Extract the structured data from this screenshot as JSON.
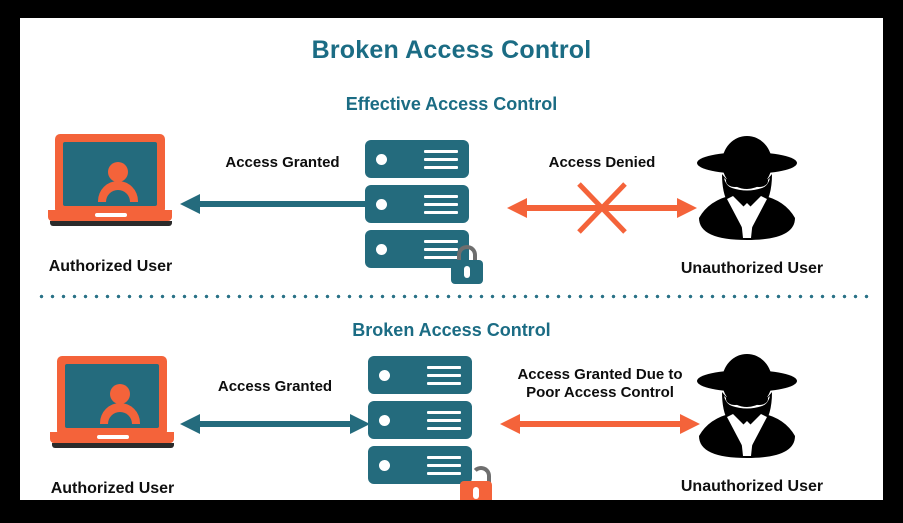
{
  "diagram": {
    "title": "Broken Access Control",
    "colors": {
      "teal": "#246b7d",
      "orange": "#f4633a",
      "title_teal": "#1b6c84",
      "black": "#000000",
      "canvas": "#ffffff"
    },
    "sections": [
      {
        "id": "effective",
        "heading": "Effective Access Control",
        "left_actor": {
          "icon": "laptop-user-icon",
          "label": "Authorized User"
        },
        "left_arrow": {
          "label": "Access Granted",
          "color": "#246b7d",
          "direction": "both",
          "blocked": false
        },
        "server": {
          "icon": "server-stack-icon",
          "units": 3,
          "lock": {
            "icon": "padlock-locked-icon",
            "state": "locked",
            "color": "#246b7d"
          }
        },
        "right_arrow": {
          "label": "Access Denied",
          "color": "#f4633a",
          "direction": "both",
          "blocked": true
        },
        "right_actor": {
          "icon": "hacker-icon",
          "label": "Unauthorized User"
        }
      },
      {
        "id": "broken",
        "heading": "Broken Access Control",
        "left_actor": {
          "icon": "laptop-user-icon",
          "label": "Authorized User"
        },
        "left_arrow": {
          "label": "Access Granted",
          "color": "#246b7d",
          "direction": "both",
          "blocked": false
        },
        "server": {
          "icon": "server-stack-icon",
          "units": 3,
          "lock": {
            "icon": "padlock-unlocked-icon",
            "state": "unlocked",
            "color": "#f4633a"
          }
        },
        "right_arrow": {
          "label_line1": "Access Granted Due to",
          "label_line2": "Poor Access Control",
          "color": "#f4633a",
          "direction": "both",
          "blocked": false
        },
        "right_actor": {
          "icon": "hacker-icon",
          "label": "Unauthorized User"
        }
      }
    ]
  }
}
